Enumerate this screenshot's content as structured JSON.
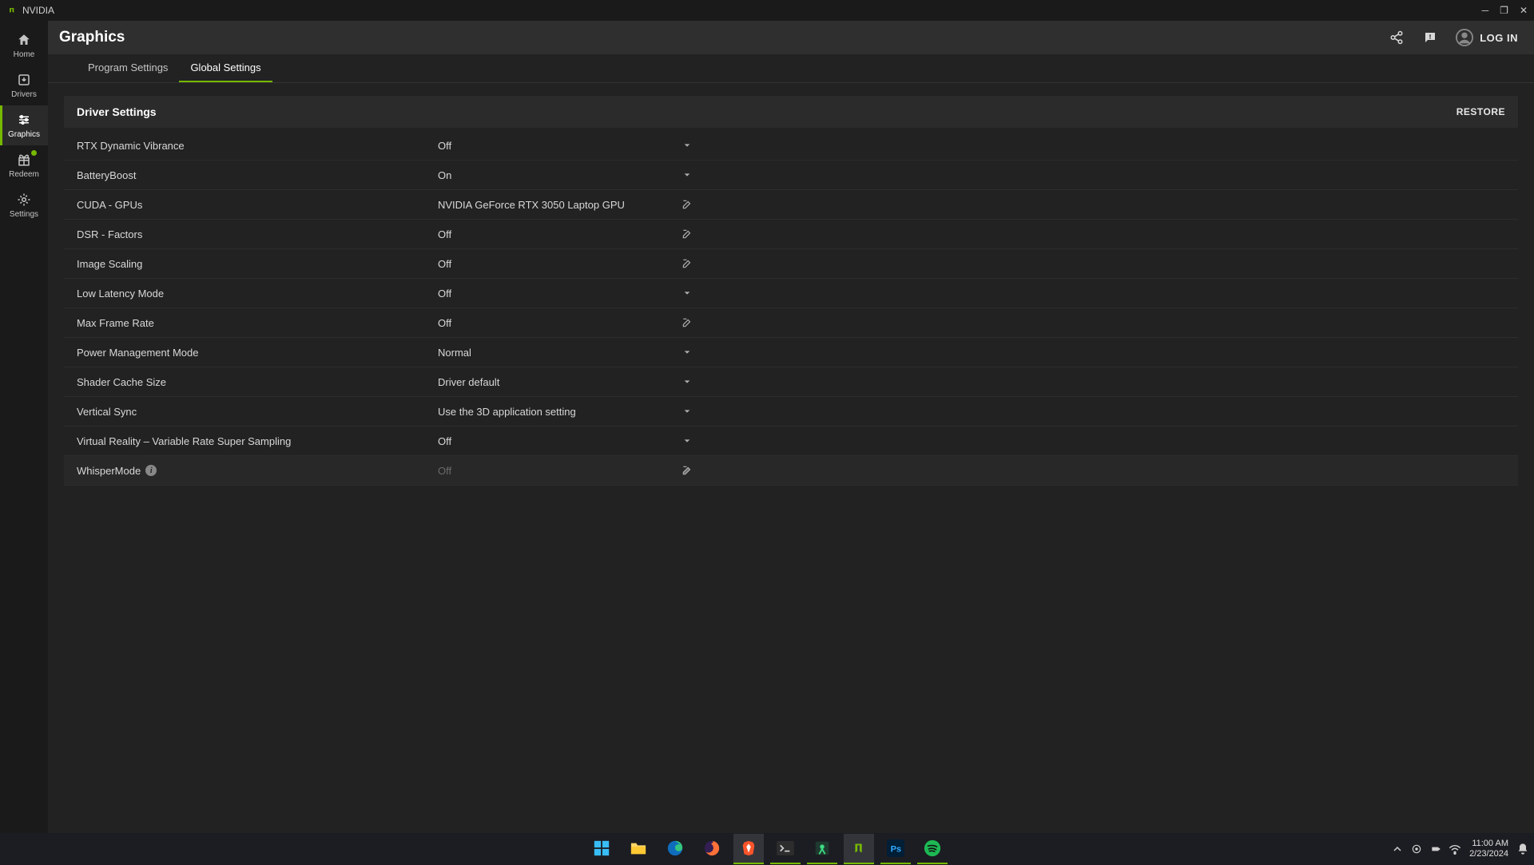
{
  "titlebar": {
    "app_name": "NVIDIA"
  },
  "sidebar": {
    "items": [
      {
        "label": "Home"
      },
      {
        "label": "Drivers"
      },
      {
        "label": "Graphics"
      },
      {
        "label": "Redeem"
      },
      {
        "label": "Settings"
      }
    ]
  },
  "header": {
    "title": "Graphics",
    "login_label": "LOG IN"
  },
  "tabs": [
    {
      "label": "Program Settings"
    },
    {
      "label": "Global Settings"
    }
  ],
  "section": {
    "title": "Driver Settings",
    "restore_label": "RESTORE"
  },
  "settings": [
    {
      "label": "RTX Dynamic Vibrance",
      "value": "Off",
      "control": "dropdown"
    },
    {
      "label": "BatteryBoost",
      "value": "On",
      "control": "dropdown"
    },
    {
      "label": "CUDA - GPUs",
      "value": "NVIDIA GeForce RTX 3050 Laptop GPU",
      "control": "edit"
    },
    {
      "label": "DSR - Factors",
      "value": "Off",
      "control": "edit"
    },
    {
      "label": "Image Scaling",
      "value": "Off",
      "control": "edit"
    },
    {
      "label": "Low Latency Mode",
      "value": "Off",
      "control": "dropdown"
    },
    {
      "label": "Max Frame Rate",
      "value": "Off",
      "control": "edit"
    },
    {
      "label": "Power Management Mode",
      "value": "Normal",
      "control": "dropdown"
    },
    {
      "label": "Shader Cache Size",
      "value": "Driver default",
      "control": "dropdown"
    },
    {
      "label": "Vertical Sync",
      "value": "Use the 3D application setting",
      "control": "dropdown"
    },
    {
      "label": "Virtual Reality – Variable Rate Super Sampling",
      "value": "Off",
      "control": "dropdown"
    },
    {
      "label": "WhisperMode",
      "value": "Off",
      "control": "edit",
      "disabled": true,
      "info": true
    }
  ],
  "taskbar": {
    "time": "11:00 AM",
    "date": "2/23/2024"
  }
}
